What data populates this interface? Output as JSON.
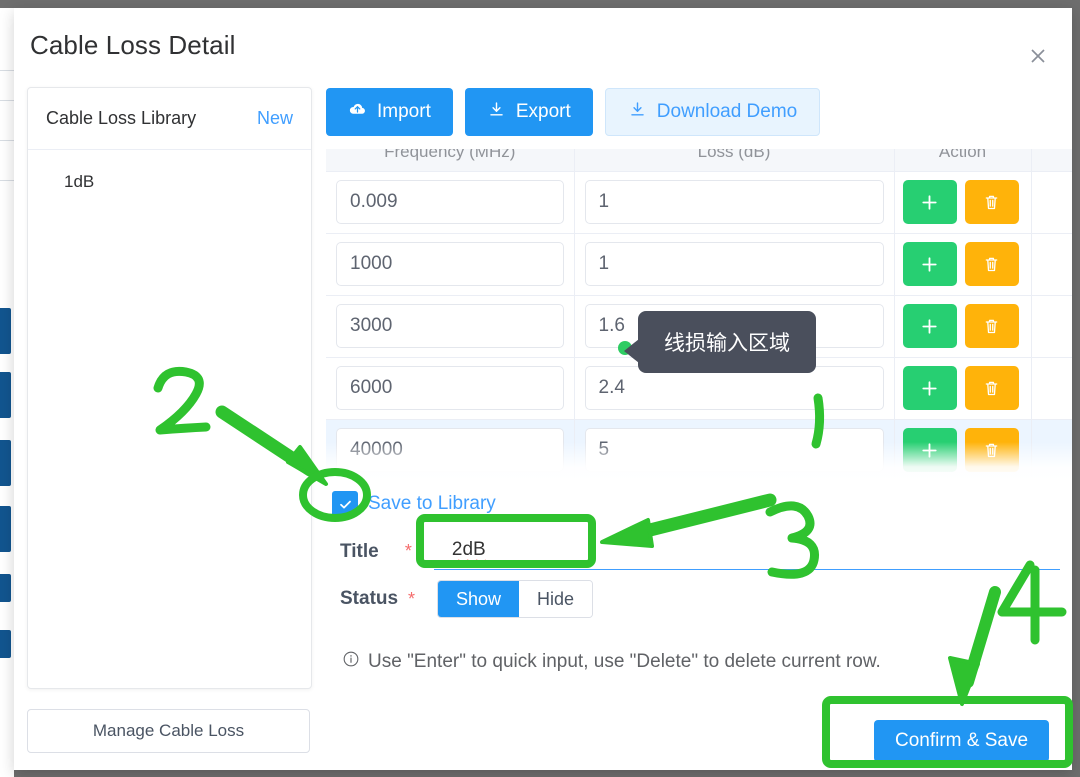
{
  "dialog": {
    "title": "Cable Loss Detail",
    "close_icon": "close-icon"
  },
  "sidebar": {
    "header_title": "Cable Loss Library",
    "new_label": "New",
    "items": [
      {
        "label": "1dB"
      }
    ],
    "manage_button": "Manage Cable Loss"
  },
  "toolbar": {
    "import_label": "Import",
    "import_icon": "cloud-upload-icon",
    "export_label": "Export",
    "export_icon": "download-icon",
    "download_demo_label": "Download Demo",
    "download_demo_icon": "download-icon"
  },
  "table": {
    "columns": [
      "Frequency (MHz)",
      "Loss (dB)",
      "Action"
    ],
    "add_icon": "plus-icon",
    "delete_icon": "trash-icon",
    "rows": [
      {
        "frequency": "0.009",
        "loss": "1",
        "highlight": false
      },
      {
        "frequency": "1000",
        "loss": "1",
        "highlight": false
      },
      {
        "frequency": "3000",
        "loss": "1.6",
        "highlight": false
      },
      {
        "frequency": "6000",
        "loss": "2.4",
        "highlight": false
      },
      {
        "frequency": "40000",
        "loss": "5",
        "highlight": true
      }
    ]
  },
  "tooltip": {
    "text": "线损输入区域"
  },
  "form": {
    "save_to_library_label": "Save to Library",
    "save_to_library_checked": true,
    "title_label": "Title",
    "title_required": "*",
    "title_value": "2dB",
    "status_label": "Status",
    "status_required": "*",
    "status_options": [
      "Show",
      "Hide"
    ],
    "status_selected": "Show",
    "hint_icon": "info-icon",
    "hint_text": "Use \"Enter\" to quick input, use \"Delete\" to delete current row.",
    "confirm_label": "Confirm & Save"
  },
  "annotations": {
    "color": "#2fc22f",
    "steps": [
      {
        "number": "2",
        "target": "save-to-library-checkbox"
      },
      {
        "number": "3",
        "target": "title-input"
      },
      {
        "number": "4",
        "target": "confirm-save-button"
      }
    ]
  }
}
